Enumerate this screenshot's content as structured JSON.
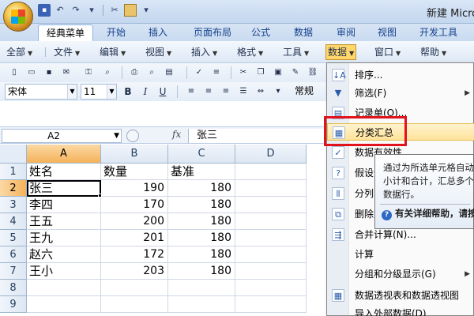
{
  "title": "新建 Micro",
  "ribbon_tabs": [
    "经典菜单",
    "开始",
    "插入",
    "页面布局",
    "公式",
    "数据",
    "审阅",
    "视图",
    "开发工具"
  ],
  "menus": [
    "全部",
    "文件",
    "编辑",
    "视图",
    "插入",
    "格式",
    "工具",
    "数据",
    "窗口",
    "帮助"
  ],
  "toolbar": {
    "font_name": "宋体",
    "font_size": "11",
    "bold": "B",
    "italic": "I",
    "underline": "U",
    "style": "常规"
  },
  "formula_bar": {
    "name_box": "A2",
    "fx": "fx",
    "content": "张三"
  },
  "grid": {
    "columns": [
      "A",
      "B",
      "C",
      "D"
    ],
    "rows": [
      "1",
      "2",
      "3",
      "4",
      "5",
      "6",
      "7",
      "8",
      "9"
    ],
    "header_row": [
      "姓名",
      "数量",
      "基准"
    ],
    "data": [
      [
        "张三",
        "190",
        "180"
      ],
      [
        "李四",
        "170",
        "180"
      ],
      [
        "王五",
        "200",
        "180"
      ],
      [
        "王九",
        "201",
        "180"
      ],
      [
        "赵六",
        "172",
        "180"
      ],
      [
        "王小",
        "203",
        "180"
      ]
    ]
  },
  "data_menu": {
    "items": [
      "排序...",
      "筛选(F)",
      "记录单(O)...",
      "分类汇总",
      "数据有效性",
      "假设分析",
      "分列",
      "删除重复项",
      "合并计算(N)...",
      "计算",
      "分组和分级显示(G)",
      "数据透视表和数据透视图",
      "导入外部数据(D)"
    ],
    "highlighted": "分类汇总"
  },
  "tooltip": {
    "lines": [
      "通过为所选单元格自动",
      "小计和合计，汇总多个",
      "数据行。"
    ],
    "help": "有关详细帮助，请按"
  }
}
